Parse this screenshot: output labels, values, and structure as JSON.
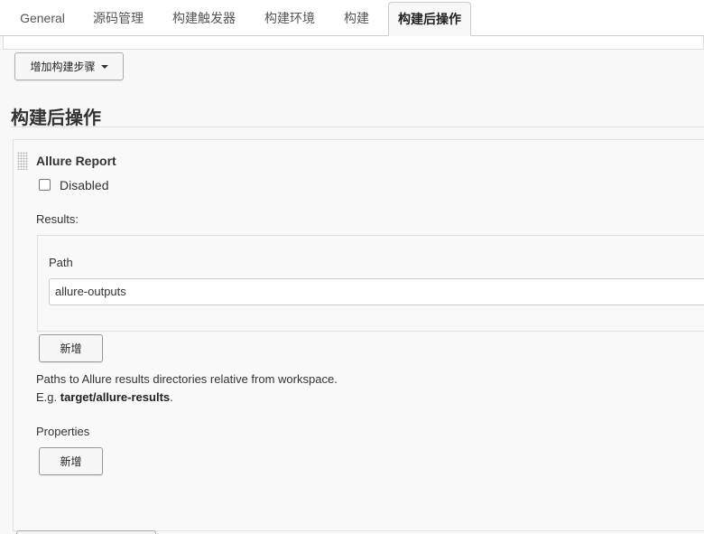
{
  "tabs": [
    {
      "label": "General",
      "active": false
    },
    {
      "label": "源码管理",
      "active": false
    },
    {
      "label": "构建触发器",
      "active": false
    },
    {
      "label": "构建环境",
      "active": false
    },
    {
      "label": "构建",
      "active": false
    },
    {
      "label": "构建后操作",
      "active": true
    }
  ],
  "toolbar": {
    "add_step_label": "增加构建步骤"
  },
  "section": {
    "title": "构建后操作"
  },
  "allure": {
    "title": "Allure Report",
    "disabled_label": "Disabled",
    "disabled_checked": false,
    "results_label": "Results:",
    "path_label": "Path",
    "path_value": "allure-outputs",
    "add_result_label": "新增",
    "help_line1": "Paths to Allure results directories relative from workspace.",
    "help_line2_prefix": "E.g. ",
    "help_line2_example": "target/allure-results",
    "help_line2_suffix": ".",
    "properties_label": "Properties",
    "add_property_label": "新增"
  }
}
